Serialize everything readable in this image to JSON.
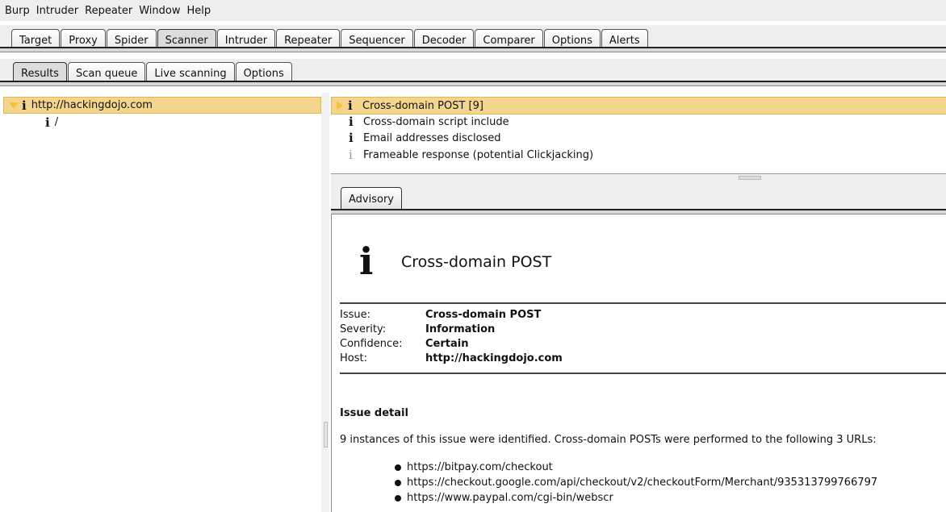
{
  "menu": [
    "Burp",
    "Intruder",
    "Repeater",
    "Window",
    "Help"
  ],
  "main_tabs": [
    "Target",
    "Proxy",
    "Spider",
    "Scanner",
    "Intruder",
    "Repeater",
    "Sequencer",
    "Decoder",
    "Comparer",
    "Options",
    "Alerts"
  ],
  "main_tab_active": "Scanner",
  "sub_tabs": [
    "Results",
    "Scan queue",
    "Live scanning",
    "Options"
  ],
  "sub_tab_active": "Results",
  "tree": {
    "host": "http://hackingdojo.com",
    "child": "/",
    "icon": "i"
  },
  "issues": [
    {
      "label": "Cross-domain POST [9]",
      "selected": true
    },
    {
      "label": "Cross-domain script include",
      "selected": false
    },
    {
      "label": "Email addresses disclosed",
      "selected": false
    },
    {
      "label": "Frameable response (potential Clickjacking)",
      "selected": false
    }
  ],
  "advisory": {
    "tab_label": "Advisory",
    "icon": "i",
    "title": "Cross-domain POST",
    "fields": [
      {
        "key": "Issue:",
        "value": "Cross-domain POST"
      },
      {
        "key": "Severity:",
        "value": "Information"
      },
      {
        "key": "Confidence:",
        "value": "Certain"
      },
      {
        "key": "Host:",
        "value": "http://hackingdojo.com"
      }
    ],
    "detail_heading": "Issue detail",
    "detail_text": "9 instances of this issue were identified. Cross-domain POSTs were performed to the following 3 URLs:",
    "urls": [
      "https://bitpay.com/checkout",
      "https://checkout.google.com/api/checkout/v2/checkoutForm/Merchant/935313799766797",
      "https://www.paypal.com/cgi-bin/webscr"
    ]
  },
  "colors": {
    "selection": "#f4d58d",
    "arrow": "#f5c23a"
  }
}
